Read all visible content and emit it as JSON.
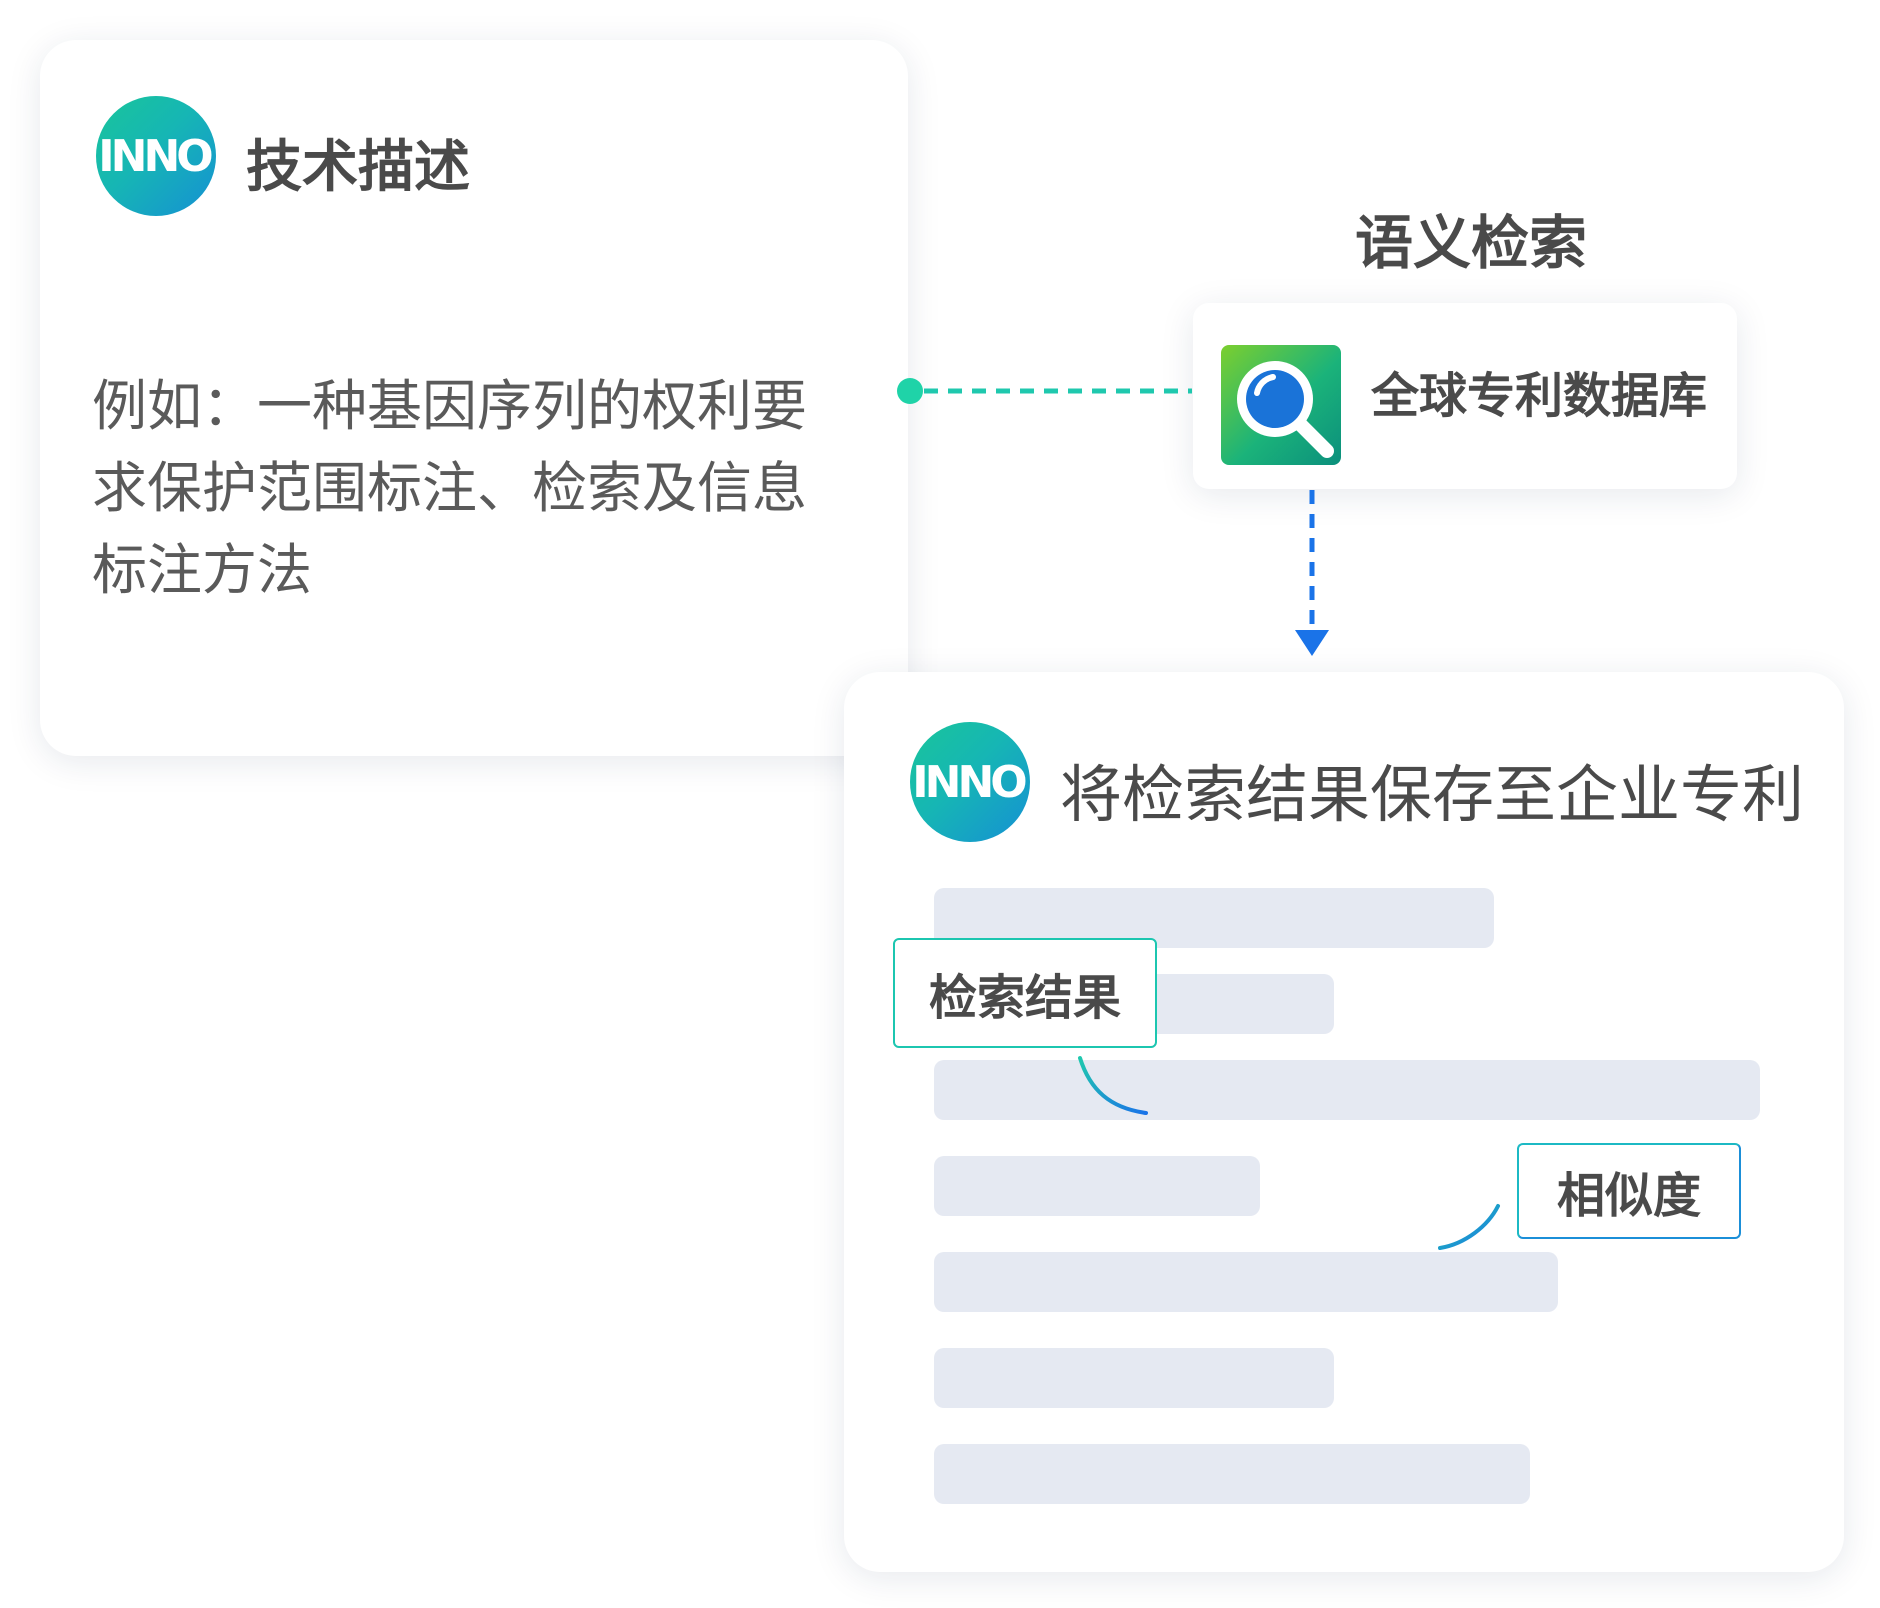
{
  "tech_card": {
    "logo_text": "INNO",
    "title": "技术描述",
    "description": "例如：一种基因序列的权利要求保护范围标注、检索及信息标注方法"
  },
  "semantic": {
    "title": "语义检索",
    "database_label": "全球专利数据库",
    "database_icon": "magnifier-icon"
  },
  "result_card": {
    "logo_text": "INNO",
    "title": "将检索结果保存至企业专利",
    "tags": {
      "result": "检索结果",
      "similarity": "相似度"
    }
  },
  "colors": {
    "connector_teal": "#1fc8ae",
    "connector_blue": "#1a73e8",
    "placeholder_bar": "#e5e9f2",
    "text": "#4a4a4a"
  }
}
